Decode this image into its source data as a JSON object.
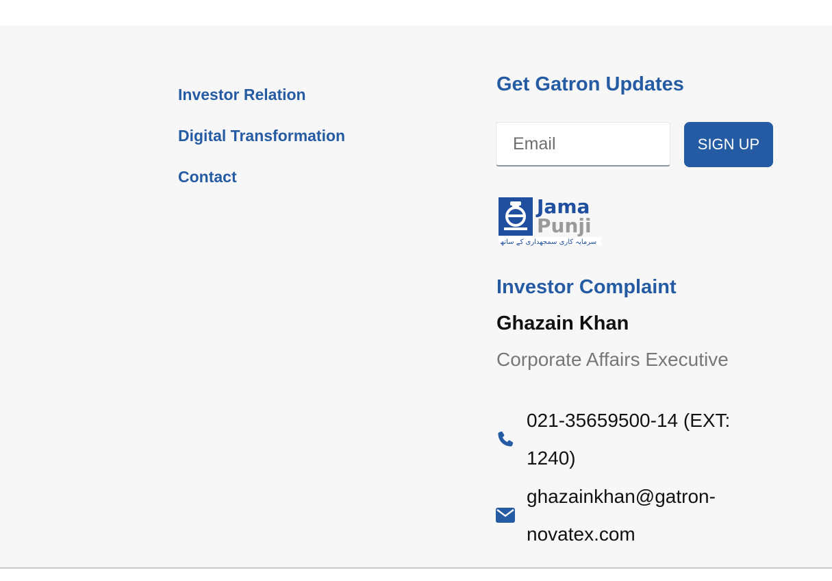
{
  "nav_links": [
    {
      "label": "Investor Relation"
    },
    {
      "label": "Digital Transformation"
    },
    {
      "label": "Contact"
    }
  ],
  "updates": {
    "title": "Get Gatron Updates",
    "email_placeholder": "Email",
    "signup_label": "SIGN UP"
  },
  "logo": {
    "name": "jama-punji-logo",
    "line1": "Jama",
    "line2": "Punji",
    "tagline": "سرمایہ کاری سمجھداری کے ساتھ"
  },
  "complaint": {
    "title": "Investor Complaint",
    "name": "Ghazain Khan",
    "role": "Corporate Affairs Executive",
    "phone": "021-35659500-14 (EXT: 1240)",
    "email": "ghazainkhan@gatron-novatex.com"
  },
  "icons": {
    "phone": "phone-icon",
    "email": "envelope-icon"
  },
  "colors": {
    "brand_blue": "#255ba3",
    "background": "#f7f7f7",
    "muted_text": "#777777"
  }
}
